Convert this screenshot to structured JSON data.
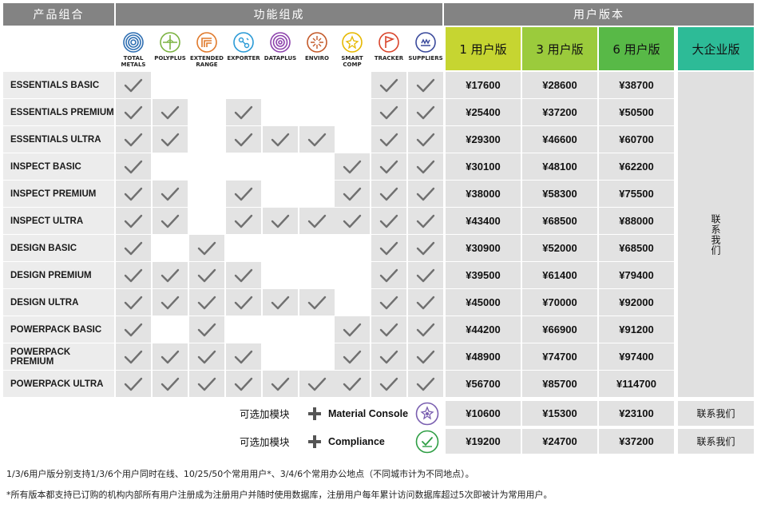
{
  "header": {
    "product_combo": "产品组合",
    "function_composition": "功能组成",
    "user_version": "用户版本"
  },
  "modules": [
    {
      "key": "total_metals",
      "label": "TOTAL\nMETALS",
      "icon": "total-metals-icon",
      "color": "#2f6fb2"
    },
    {
      "key": "polyplus",
      "label": "POLYPLUS",
      "icon": "polyplus-icon",
      "color": "#7cb342"
    },
    {
      "key": "extended_range",
      "label": "EXTENDED\nRANGE",
      "icon": "extended-range-icon",
      "color": "#e07a2c"
    },
    {
      "key": "exporter",
      "label": "EXPORTER",
      "icon": "exporter-icon",
      "color": "#2a9ad6"
    },
    {
      "key": "dataplus",
      "label": "DATAPLUS",
      "icon": "dataplus-icon",
      "color": "#8e44ad"
    },
    {
      "key": "enviro",
      "label": "ENVIRO",
      "icon": "enviro-icon",
      "color": "#c45a2a"
    },
    {
      "key": "smart_comp",
      "label": "SMART\nCOMP",
      "icon": "smart-comp-icon",
      "color": "#e6b800"
    },
    {
      "key": "tracker",
      "label": "TRACKER",
      "icon": "tracker-icon",
      "color": "#d9442b"
    },
    {
      "key": "suppliers",
      "label": "SUPPLIERS",
      "icon": "suppliers-icon",
      "color": "#3a4a9c"
    }
  ],
  "tiers": [
    {
      "label": "1 用户版",
      "color": "#c6d531"
    },
    {
      "label": "3 用户版",
      "color": "#9bcb3c"
    },
    {
      "label": "6 用户版",
      "color": "#58b947"
    },
    {
      "label": "大企业版",
      "color": "#2dbb97"
    }
  ],
  "enterprise_contact": "联系我们",
  "rows": [
    {
      "name": "ESSENTIALS BASIC",
      "checks": [
        1,
        0,
        0,
        0,
        0,
        0,
        0,
        1,
        1
      ],
      "prices": [
        "¥17600",
        "¥28600",
        "¥38700"
      ]
    },
    {
      "name": "ESSENTIALS PREMIUM",
      "checks": [
        1,
        1,
        0,
        1,
        0,
        0,
        0,
        1,
        1
      ],
      "prices": [
        "¥25400",
        "¥37200",
        "¥50500"
      ]
    },
    {
      "name": "ESSENTIALS ULTRA",
      "checks": [
        1,
        1,
        0,
        1,
        1,
        1,
        0,
        1,
        1
      ],
      "prices": [
        "¥29300",
        "¥46600",
        "¥60700"
      ]
    },
    {
      "name": "INSPECT BASIC",
      "checks": [
        1,
        0,
        0,
        0,
        0,
        0,
        1,
        1,
        1
      ],
      "prices": [
        "¥30100",
        "¥48100",
        "¥62200"
      ]
    },
    {
      "name": "INSPECT PREMIUM",
      "checks": [
        1,
        1,
        0,
        1,
        0,
        0,
        1,
        1,
        1
      ],
      "prices": [
        "¥38000",
        "¥58300",
        "¥75500"
      ]
    },
    {
      "name": "INSPECT ULTRA",
      "checks": [
        1,
        1,
        0,
        1,
        1,
        1,
        1,
        1,
        1
      ],
      "prices": [
        "¥43400",
        "¥68500",
        "¥88000"
      ]
    },
    {
      "name": "DESIGN BASIC",
      "checks": [
        1,
        0,
        1,
        0,
        0,
        0,
        0,
        1,
        1
      ],
      "prices": [
        "¥30900",
        "¥52000",
        "¥68500"
      ]
    },
    {
      "name": "DESIGN PREMIUM",
      "checks": [
        1,
        1,
        1,
        1,
        0,
        0,
        0,
        1,
        1
      ],
      "prices": [
        "¥39500",
        "¥61400",
        "¥79400"
      ]
    },
    {
      "name": "DESIGN ULTRA",
      "checks": [
        1,
        1,
        1,
        1,
        1,
        1,
        0,
        1,
        1
      ],
      "prices": [
        "¥45000",
        "¥70000",
        "¥92000"
      ]
    },
    {
      "name": "POWERPACK BASIC",
      "checks": [
        1,
        0,
        1,
        0,
        0,
        0,
        1,
        1,
        1
      ],
      "prices": [
        "¥44200",
        "¥66900",
        "¥91200"
      ]
    },
    {
      "name": "POWERPACK PREMIUM",
      "checks": [
        1,
        1,
        1,
        1,
        0,
        0,
        1,
        1,
        1
      ],
      "prices": [
        "¥48900",
        "¥74700",
        "¥97400"
      ]
    },
    {
      "name": "POWERPACK ULTRA",
      "checks": [
        1,
        1,
        1,
        1,
        1,
        1,
        1,
        1,
        1
      ],
      "prices": [
        "¥56700",
        "¥85700",
        "¥114700"
      ]
    }
  ],
  "addons": [
    {
      "optional_label": "可选加模块",
      "name": "Material Console",
      "icon": "material-console-icon",
      "icon_color": "#7a5fb0",
      "prices": [
        "¥10600",
        "¥15300",
        "¥23100"
      ],
      "enterprise": "联系我们"
    },
    {
      "optional_label": "可选加模块",
      "name": "Compliance",
      "icon": "compliance-icon",
      "icon_color": "#2e9e44",
      "prices": [
        "¥19200",
        "¥24700",
        "¥37200"
      ],
      "enterprise": "联系我们"
    }
  ],
  "notes": [
    "1/3/6用户版分别支持1/3/6个用户同时在线、10/25/50个常用用户*、3/4/6个常用办公地点（不同城市计为不同地点）。",
    "*所有版本都支持已订购的机构内部所有用户注册成为注册用户并随时使用数据库，注册用户每年累计访问数据库超过5次即被计为常用用户。"
  ]
}
